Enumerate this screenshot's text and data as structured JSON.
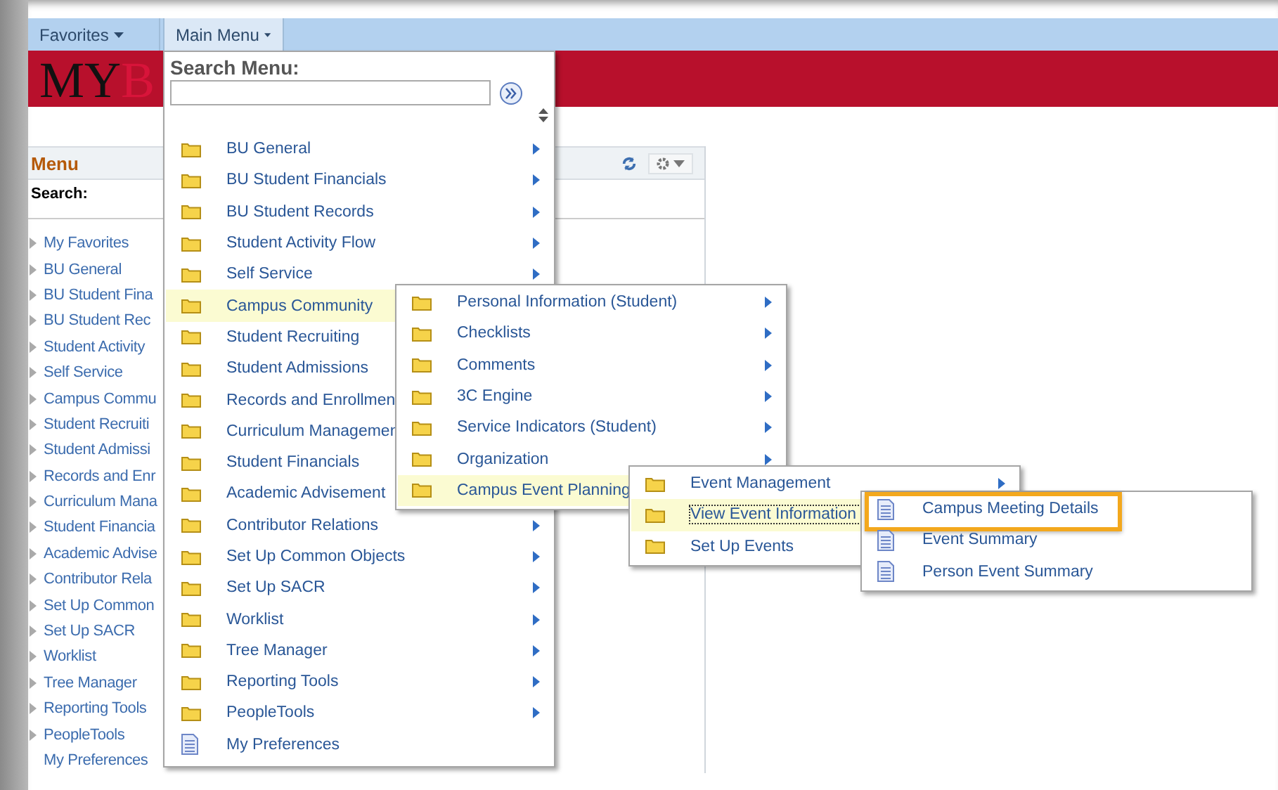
{
  "nav": {
    "tabs": [
      {
        "label": "Favorites",
        "selected": false
      },
      {
        "label": "Main Menu",
        "selected": true
      }
    ]
  },
  "banner": {
    "logo_dark": "MY",
    "logo_light": "B"
  },
  "menu_panel": {
    "title": "Menu",
    "search_label": "Search:",
    "items": [
      {
        "label": "My Favorites",
        "expandable": true
      },
      {
        "label": "BU General",
        "expandable": true
      },
      {
        "label": "BU Student Fina",
        "expandable": true
      },
      {
        "label": "BU Student Rec",
        "expandable": true
      },
      {
        "label": "Student Activity",
        "expandable": true
      },
      {
        "label": "Self Service",
        "expandable": true
      },
      {
        "label": "Campus Commu",
        "expandable": true
      },
      {
        "label": "Student Recruiti",
        "expandable": true
      },
      {
        "label": "Student Admissi",
        "expandable": true
      },
      {
        "label": "Records and Enr",
        "expandable": true
      },
      {
        "label": "Curriculum Mana",
        "expandable": true
      },
      {
        "label": "Student Financia",
        "expandable": true
      },
      {
        "label": "Academic Advise",
        "expandable": true
      },
      {
        "label": "Contributor Rela",
        "expandable": true
      },
      {
        "label": "Set Up Common",
        "expandable": true
      },
      {
        "label": "Set Up SACR",
        "expandable": true
      },
      {
        "label": "Worklist",
        "expandable": true
      },
      {
        "label": "Tree Manager",
        "expandable": true
      },
      {
        "label": "Reporting Tools",
        "expandable": true
      },
      {
        "label": "PeopleTools",
        "expandable": true
      },
      {
        "label": "My Preferences",
        "expandable": false
      }
    ]
  },
  "main_menu": {
    "search_title": "Search Menu:",
    "items": [
      {
        "kind": "folder",
        "label": "BU General",
        "arrow": true,
        "selected": false
      },
      {
        "kind": "folder",
        "label": "BU Student Financials",
        "arrow": true,
        "selected": false
      },
      {
        "kind": "folder",
        "label": "BU Student Records",
        "arrow": true,
        "selected": false
      },
      {
        "kind": "folder",
        "label": "Student Activity Flow",
        "arrow": true,
        "selected": false
      },
      {
        "kind": "folder",
        "label": "Self Service",
        "arrow": true,
        "selected": false
      },
      {
        "kind": "folder",
        "label": "Campus Community",
        "arrow": false,
        "selected": true
      },
      {
        "kind": "folder",
        "label": "Student Recruiting",
        "arrow": false,
        "selected": false
      },
      {
        "kind": "folder",
        "label": "Student Admissions",
        "arrow": false,
        "selected": false
      },
      {
        "kind": "folder",
        "label": "Records and Enrollmen",
        "arrow": false,
        "selected": false
      },
      {
        "kind": "folder",
        "label": "Curriculum Managemen",
        "arrow": false,
        "selected": false
      },
      {
        "kind": "folder",
        "label": "Student Financials",
        "arrow": false,
        "selected": false
      },
      {
        "kind": "folder",
        "label": "Academic Advisement",
        "arrow": false,
        "selected": false
      },
      {
        "kind": "folder",
        "label": "Contributor Relations",
        "arrow": true,
        "selected": false
      },
      {
        "kind": "folder",
        "label": "Set Up Common Objects",
        "arrow": true,
        "selected": false
      },
      {
        "kind": "folder",
        "label": "Set Up SACR",
        "arrow": true,
        "selected": false
      },
      {
        "kind": "folder",
        "label": "Worklist",
        "arrow": true,
        "selected": false
      },
      {
        "kind": "folder",
        "label": "Tree Manager",
        "arrow": true,
        "selected": false
      },
      {
        "kind": "folder",
        "label": "Reporting Tools",
        "arrow": true,
        "selected": false
      },
      {
        "kind": "folder",
        "label": "PeopleTools",
        "arrow": true,
        "selected": false
      },
      {
        "kind": "page",
        "label": "My Preferences",
        "arrow": false,
        "selected": false
      }
    ]
  },
  "submenus": [
    {
      "items": [
        {
          "kind": "folder",
          "label": "Personal Information (Student)",
          "arrow": true,
          "selected": false
        },
        {
          "kind": "folder",
          "label": "Checklists",
          "arrow": true,
          "selected": false
        },
        {
          "kind": "folder",
          "label": "Comments",
          "arrow": true,
          "selected": false
        },
        {
          "kind": "folder",
          "label": "3C Engine",
          "arrow": true,
          "selected": false
        },
        {
          "kind": "folder",
          "label": "Service Indicators (Student)",
          "arrow": true,
          "selected": false
        },
        {
          "kind": "folder",
          "label": "Organization",
          "arrow": true,
          "selected": false
        },
        {
          "kind": "folder",
          "label": "Campus Event Planning",
          "arrow": false,
          "selected": true
        }
      ]
    },
    {
      "items": [
        {
          "kind": "folder",
          "label": "Event Management",
          "arrow": true,
          "selected": false
        },
        {
          "kind": "folder",
          "label": "View Event Information",
          "arrow": false,
          "selected": true
        },
        {
          "kind": "folder",
          "label": "Set Up Events",
          "arrow": false,
          "selected": false
        }
      ]
    },
    {
      "items": [
        {
          "kind": "page",
          "label": "Campus Meeting Details",
          "arrow": false,
          "selected": false,
          "outlined": true
        },
        {
          "kind": "page",
          "label": "Event Summary",
          "arrow": false,
          "selected": false,
          "outlined": false
        },
        {
          "kind": "page",
          "label": "Person Event Summary",
          "arrow": false,
          "selected": false,
          "outlined": false
        }
      ]
    }
  ]
}
